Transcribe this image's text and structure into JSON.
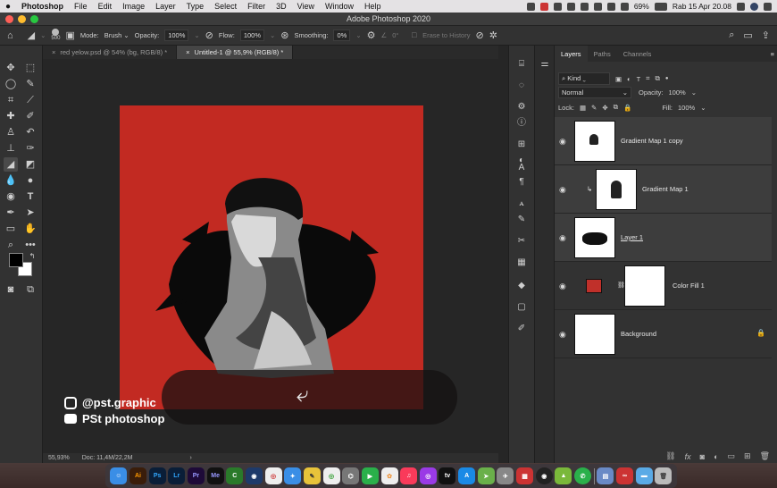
{
  "menubar": {
    "apple": "",
    "app": "Photoshop",
    "items": [
      "File",
      "Edit",
      "Image",
      "Layer",
      "Type",
      "Select",
      "Filter",
      "3D",
      "View",
      "Window",
      "Help"
    ],
    "battery": "69%",
    "datetime": "Rab 15 Apr  20.08"
  },
  "window": {
    "title": "Adobe Photoshop 2020"
  },
  "options": {
    "brush_size": "500",
    "mode_label": "Mode:",
    "mode_value": "Brush",
    "opacity_label": "Opacity:",
    "opacity_value": "100%",
    "flow_label": "Flow:",
    "flow_value": "100%",
    "smoothing_label": "Smoothing:",
    "smoothing_value": "0%",
    "angle_value": "0°",
    "erase_history": "Erase to History"
  },
  "tabs": [
    {
      "label": "red yelow.psd @ 54% (bg, RGB/8) *"
    },
    {
      "label": "Untitled-1 @ 55,9% (RGB/8) *"
    }
  ],
  "status": {
    "zoom": "55,93%",
    "doc": "Doc: 11,4M/22,2M"
  },
  "overlay": {
    "instagram": "@pst.graphic",
    "youtube": "PSt photoshop"
  },
  "layers_panel": {
    "tabs": [
      "Layers",
      "Paths",
      "Channels"
    ],
    "filter_kind": "Kind",
    "blend_mode": "Normal",
    "opacity_label": "Opacity:",
    "opacity_value": "100%",
    "lock_label": "Lock:",
    "fill_label": "Fill:",
    "fill_value": "100%",
    "layers": [
      {
        "name": "Gradient Map 1 copy"
      },
      {
        "name": "Gradient Map 1"
      },
      {
        "name": "Layer 1"
      },
      {
        "name": "Color Fill 1"
      },
      {
        "name": "Background"
      }
    ]
  },
  "colors": {
    "artboard": "#c22a22",
    "foreground": "#000000",
    "background": "#ffffff",
    "fill_swatch": "#c0302a"
  },
  "dock": [
    "finder",
    "illustrator",
    "photoshop",
    "lightroom",
    "premiere",
    "media-encoder",
    "corel",
    "after-effects",
    "chrome",
    "safari",
    "appstore",
    "chrome",
    "capture",
    "facetime",
    "photos",
    "music",
    "podcasts",
    "tv",
    "appstore",
    "maps",
    "launchpad",
    "bitdefender",
    "obs",
    "android",
    "whatsapp",
    "preview",
    "acrobat",
    "folder",
    "trash"
  ]
}
